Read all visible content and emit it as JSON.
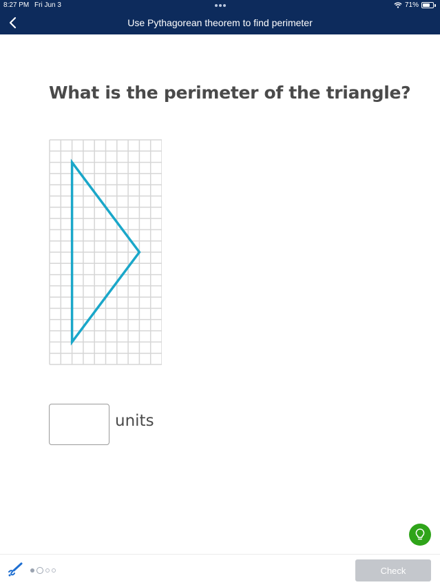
{
  "status_bar": {
    "time": "8:27 PM",
    "date": "Fri Jun 3",
    "battery_percent": "71%",
    "battery_level": 0.71
  },
  "nav": {
    "title": "Use Pythagorean theorem to find perimeter"
  },
  "question": {
    "text": "What is the perimeter of the triangle?"
  },
  "figure": {
    "grid_columns": 10,
    "grid_rows": 20,
    "grid_color": "#d6d6d6",
    "triangle_color": "#1aa7c9",
    "triangle_vertices_grid": [
      [
        2,
        2
      ],
      [
        2,
        18
      ],
      [
        8,
        10
      ]
    ]
  },
  "answer": {
    "value": "",
    "units_label": "units"
  },
  "footer": {
    "check_label": "Check",
    "progress": {
      "total": 4,
      "completed": 1,
      "current": 2
    }
  },
  "colors": {
    "header_bg": "#0d2b5c",
    "hint_green": "#2fa41a",
    "check_disabled": "#c4c7cc",
    "scratchpad_blue": "#1f6fd1"
  }
}
